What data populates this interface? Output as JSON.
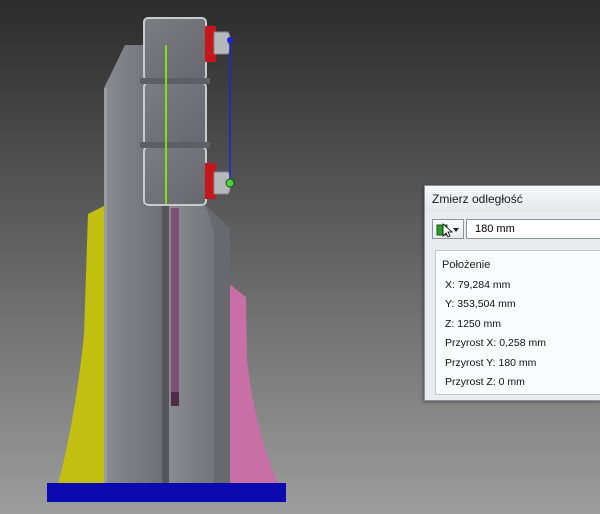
{
  "dialog": {
    "title": "Zmierz odległość",
    "distance_value": "180 mm",
    "position_section": {
      "title": "Położenie",
      "rows": [
        "X: 79,284 mm",
        "Y: 353,504 mm",
        "Z: 1250 mm",
        "Przyrost X: 0,258 mm",
        "Przyrost Y: 180 mm",
        "Przyrost Z: 0 mm"
      ]
    }
  },
  "colors": {
    "profile_gray": "#7a7b80",
    "side_yellow": "#c1bf0f",
    "side_pink": "#c86fa6",
    "base_blue": "#0a0ab0",
    "clamp_red": "#c4161b",
    "measure_line": "#2020e0",
    "center_green": "#7de012"
  }
}
